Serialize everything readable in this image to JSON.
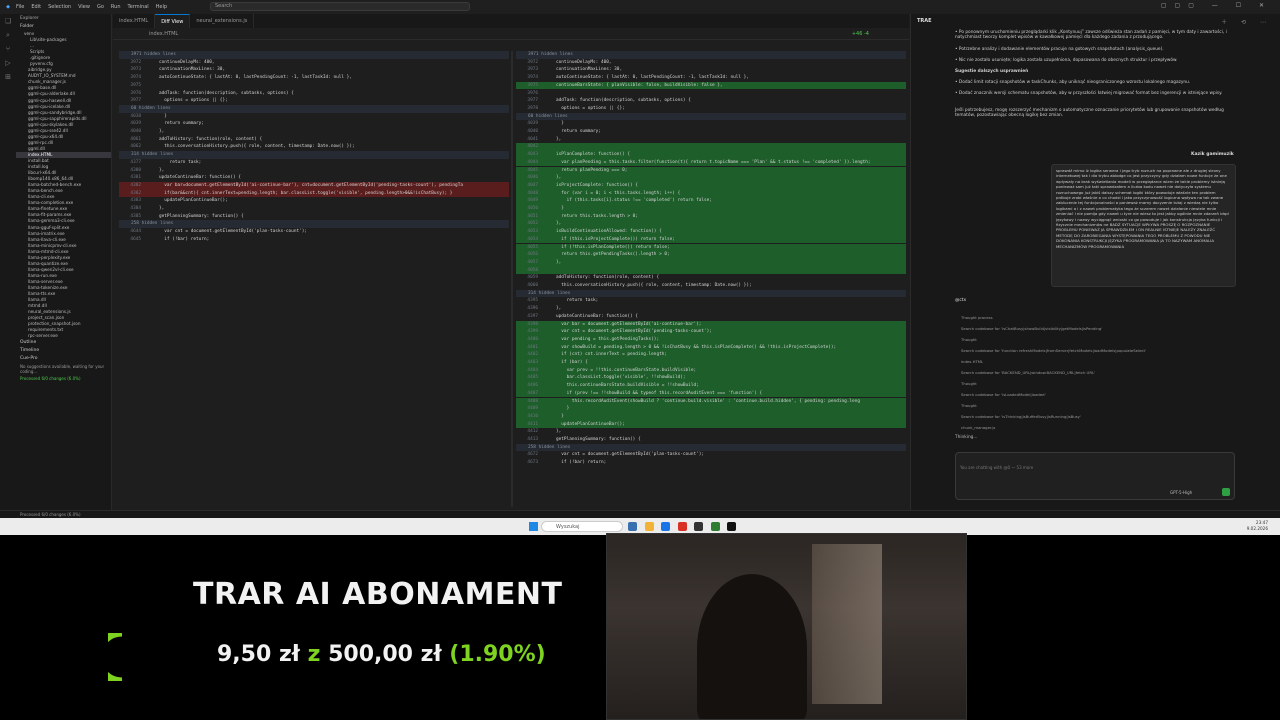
{
  "titlebar": {
    "menu": [
      "File",
      "Edit",
      "Selection",
      "View",
      "Go",
      "Run",
      "Terminal",
      "Help"
    ],
    "search": "Search"
  },
  "explorer": {
    "header": "Explorer",
    "folder": "Folder",
    "tree": [
      "venv",
      "Lib\\site-packages",
      "...",
      "Scripts",
      ".gitignore",
      "pyvenv.cfg",
      "aibridge.py",
      "AUDYT_IO_SYSTEM.md",
      "chunk_manager.js",
      "ggml-base.dll",
      "ggml-cpu-alderlake.dll",
      "ggml-cpu-haswell.dll",
      "ggml-cpu-icelake.dll",
      "ggml-cpu-sandybridge.dll",
      "ggml-cpu-sapphirerapids.dll",
      "ggml-cpu-skylakex.dll",
      "ggml-cpu-sse42.dll",
      "ggml-cpu-x64.dll",
      "ggml-rpc.dll",
      "ggml.dll",
      "index.HTML",
      "install.bat",
      "install.log",
      "libcurl-x64.dll",
      "libomp140.x86_64.dll",
      "llama-batched-bench.exe",
      "llama-bench.exe",
      "llama-cli.exe",
      "llama-completion.exe",
      "llama-finetune.exe",
      "llama-fit-params.exe",
      "llama-gemma3-cli.exe",
      "llama-gguf-split.exe",
      "llama-imatrix.exe",
      "llama-llava-cli.exe",
      "llama-minicpmv-cli.exe",
      "llama-mtmd-cli.exe",
      "llama-perplexity.exe",
      "llama-quantize.exe",
      "llama-qwen2vl-cli.exe",
      "llama-run.exe",
      "llama-server.exe",
      "llama-tokenize.exe",
      "llama-tts.exe",
      "llama.dll",
      "mtmd.dll",
      "neural_extensions.js",
      "project_scan.json",
      "protection_snapshot.json",
      "requirements.txt",
      "rpc-server.exe"
    ],
    "selected": "index.HTML",
    "outline": "Outline",
    "timeline": "Timeline",
    "cursor": "Cue-Pro",
    "cursor_note": "No suggestions available, waiting for your coding...",
    "cursor_status": "Processed 6/0 changes (6.0%)"
  },
  "tabs": [
    "index.HTML",
    "Diff View",
    "neural_extensions.js"
  ],
  "breadcrumb": "index.HTML",
  "diff_stat": "+46 -4",
  "left_pane": [
    {
      "t": "hidden",
      "text": "3971 hidden lines"
    },
    {
      "n": "3972",
      "text": "continueDelayMs: 400,"
    },
    {
      "n": "3973",
      "text": "continuationMaxLines: 30,"
    },
    {
      "n": "3974",
      "text": "autoContinueState: { lastAt: 0, lastPendingCount: -1, lastTaskId: null },"
    },
    {
      "n": "3975",
      "text": ""
    },
    {
      "n": "3976",
      "text": "addTask: function(description, subtasks, options) {"
    },
    {
      "n": "3977",
      "text": "  options = options || {};"
    },
    {
      "t": "hidden",
      "text": "60 hidden lines"
    },
    {
      "n": "4038",
      "text": "  }"
    },
    {
      "n": "4039",
      "text": "  return summary;"
    },
    {
      "n": "4040",
      "text": "},"
    },
    {
      "n": "4061",
      "text": "addToHistory: function(role, content) {"
    },
    {
      "n": "4062",
      "text": "  this.conversationHistory.push({ role, content, timestamp: Date.now() });"
    },
    {
      "t": "hidden",
      "text": "314 hidden lines"
    },
    {
      "n": "4377",
      "text": "    return task;"
    },
    {
      "n": "4380",
      "text": "},"
    },
    {
      "n": "4381",
      "text": "updateContinueBar: function() {"
    },
    {
      "n": "4382",
      "text": "  var bar=document.getElementById('ai-continue-bar'), cnt=document.getElementById('pending-tasks-count'), pendingTa"
    },
    {
      "n": "4382",
      "text": "  if(bar&&cnt){ cnt.innerText=pending.length; bar.classList.toggle('visible', pending.length>0&&!isChatBusy); }"
    },
    {
      "n": "4383",
      "text": "  updatePlanContinueBar();"
    },
    {
      "n": "4384",
      "text": "},"
    },
    {
      "n": "4385",
      "text": "getPlanningSummary: function() {"
    },
    {
      "t": "hidden",
      "text": "258 hidden lines"
    },
    {
      "n": "4644",
      "text": "  var cnt = document.getElementById('plan-tasks-count');"
    },
    {
      "n": "4645",
      "text": "  if (!bar) return;"
    }
  ],
  "right_pane": [
    {
      "t": "hidden",
      "text": "3971 hidden lines"
    },
    {
      "n": "3972",
      "text": "continueDelayMs: 400,"
    },
    {
      "n": "3973",
      "text": "continuationMaxLines: 30,"
    },
    {
      "n": "3974",
      "text": "autoContinueState: { lastAt: 0, lastPendingCount: -1, lastTaskId: null },"
    },
    {
      "n": "3975",
      "text": "continueBarsState: { planVisible: false, buildVisible: false },"
    },
    {
      "n": "3976",
      "text": ""
    },
    {
      "n": "3977",
      "text": "addTask: function(description, subtasks, options) {"
    },
    {
      "n": "3978",
      "text": "  options = options || {};"
    },
    {
      "t": "hidden",
      "text": "60 hidden lines"
    },
    {
      "n": "4039",
      "text": "  }"
    },
    {
      "n": "4040",
      "text": "  return summary;"
    },
    {
      "n": "4041",
      "text": "},"
    },
    {
      "n": "4042",
      "text": ""
    },
    {
      "n": "4043",
      "text": "isPlanComplete: function() {"
    },
    {
      "n": "4044",
      "text": "  var planPending = this.tasks.filter(function(t){ return t.topicName === 'Plan' && t.status !== 'completed' }).length;"
    },
    {
      "n": "4045",
      "text": "  return planPending === 0;"
    },
    {
      "n": "4046",
      "text": "},"
    },
    {
      "n": "4047",
      "text": "isProjectComplete: function() {"
    },
    {
      "n": "4048",
      "text": "  for (var i = 0; i < this.tasks.length; i++) {"
    },
    {
      "n": "4049",
      "text": "    if (this.tasks[i].status !== 'completed') return false;"
    },
    {
      "n": "4050",
      "text": "  }"
    },
    {
      "n": "4051",
      "text": "  return this.tasks.length > 0;"
    },
    {
      "n": "4052",
      "text": "},"
    },
    {
      "n": "4053",
      "text": "isBuildContinuationAllowed: function() {"
    },
    {
      "n": "4054",
      "text": "  if (this.isProjectComplete()) return false;"
    },
    {
      "n": "4055",
      "text": "  if (!this.isPlanComplete()) return false;"
    },
    {
      "n": "4056",
      "text": "  return this.getPendingTasks().length > 0;"
    },
    {
      "n": "4057",
      "text": "},"
    },
    {
      "n": "4058",
      "text": ""
    },
    {
      "n": "4059",
      "text": "addToHistory: function(role, content) {"
    },
    {
      "n": "4060",
      "text": "  this.conversationHistory.push({ role, content, timestamp: Date.now() });"
    },
    {
      "t": "hidden",
      "text": "314 hidden lines"
    },
    {
      "n": "4395",
      "text": "    return task;"
    },
    {
      "n": "4396",
      "text": "},"
    },
    {
      "n": "4397",
      "text": "updateContinueBar: function() {"
    },
    {
      "n": "4398",
      "text": "  var bar = document.getElementById('ai-continue-bar');"
    },
    {
      "n": "4399",
      "text": "  var cnt = document.getElementById('pending-tasks-count');"
    },
    {
      "n": "4400",
      "text": "  var pending = this.getPendingTasks();"
    },
    {
      "n": "4401",
      "text": "  var showBuild = pending.length > 0 && !isChatBusy && this.isPlanComplete() && !this.isProjectComplete();"
    },
    {
      "n": "4402",
      "text": "  if (cnt) cnt.innerText = pending.length;"
    },
    {
      "n": "4403",
      "text": "  if (bar) {"
    },
    {
      "n": "4404",
      "text": "    var prev = !!this.continueBarsState.buildVisible;"
    },
    {
      "n": "4405",
      "text": "    bar.classList.toggle('visible', !!showBuild);"
    },
    {
      "n": "4406",
      "text": "    this.continueBarsState.buildVisible = !!showBuild;"
    },
    {
      "n": "4407",
      "text": "    if (prev !== !!showBuild && typeof this.recordAuditEvent === 'function') {"
    },
    {
      "n": "4408",
      "text": "      this.recordAuditEvent(showBuild ? 'continue.build.visible' : 'continue.build.hidden', { pending: pending.leng"
    },
    {
      "n": "4409",
      "text": "    }"
    },
    {
      "n": "4410",
      "text": "  }"
    },
    {
      "n": "4411",
      "text": "  updatePlanContinueBar();"
    },
    {
      "n": "4412",
      "text": "},"
    },
    {
      "n": "4413",
      "text": "getPlanningSummary: function() {"
    },
    {
      "t": "hidden",
      "text": "258 hidden lines"
    },
    {
      "n": "4672",
      "text": "  var cnt = document.getElementById('plan-tasks-count');"
    },
    {
      "n": "4673",
      "text": "  if (!bar) return;"
    }
  ],
  "chat": {
    "title": "TRAE",
    "assistant_text": [
      "Po ponownym uruchomieniu przeglądarki klik „Kontynuuj” zawsze odświeża stan zadań z pamięci, w tym daty i zawartości, i natychmiast tworzy komplet wpisów w kawałkowej pamięci dla każdego zadania z przodującego.",
      "Potrzebne analizy i dodawanie elementów pracuje na gotowych snapshotach (analysis_queue).",
      "Nic nie zostało usunięte; logika została uzupełniona, dopasowana do obecnych struktur i przepływów.",
      "Sugestie dalszych usprawnień",
      "Dodać limit rotacji snapshotów w taskChunks, aby uniknąć nieograniczonego wzrostu lokalnego magazynu.",
      "Dodać znacznik wersji schematu snapshotów, aby w przyszłości łatwiej migrować format bez ingerencji w istniejące wpisy.",
      "Jeśli potrzebujesz, mogę rozszerzyć mechanizm o automatyczne oznaczanie priorytetów lub grupowanie snapshotów według tematów, pozostawiając obecną logikę bez zmian."
    ],
    "user_name": "Kazik gamimuzik",
    "user_message": "sprawdź mimo iż logika serwera i jego tryb rozruch na poprawne ale z drugiej strony internetowej tak i dla trybu ablodge co jest przyczyny gdy działam nowe funkcje że one wpływały na brak wyświetlania modeli w przeglądarce wiem że takie problemy istnieją ponieważ sam już taki sprawdzałem a liczba kodu nawet nie dotyczyła systemu rozruchowego już jakiś dalszy schemat logiki który powoduje właśnie ten problem próbuje zrobi właśnie o co chodzi i jaka przyczynowość logiczna wpływa na tak zwane zablucenie tej funkcjonalności a ponieważ mamy docyzenie tutaj z wiedzą nie tylko logikami a i z nawet problematyka tego że sczerem nawet działanie niewiele mnie zmieniać i nie pomija gdy nawet u tyre nie wiesz to jest jakby ogólnie mnie zdarzeń błąd językowy i nazwy wyciągnąć wnioski co go powoduje i jak konstrukcja języka funkcji i fizycznie mechanizmów ne BADŹ SYTUACJE WPŁYWA PROSZĘ O ROZPOZNANIE PROBLEMU PONIEWAŻ JA SPRAWDZIŁEM I ON REALNIE ISTNIEJE NALEŻY ZNALEŹĆ METODĘ DO ZAROBIEGANIA WYSTĘPOWANIA TEGO PROBLEMU Z POWODU NIE DOKONANIA KONSTRUKCJI JĘZYKA PROGRAMOWANIA JA TO NAZYWAM ANOMALIA MECHANIZMÓW PROGRAMOWANIA",
    "steps": [
      "Thought process",
      "Search codebase for 'isChatBusy|showBuild|visibility|getModels|isPending'",
      "Thought",
      "Search codebase for 'function refreshModels|fromServer|fetchModels|loadModels|populateSelect'",
      "index.HTML",
      "Search codebase for 'BACKEND_URL|window.BACKEND_URL|fetch URL'",
      "Thought",
      "Search codebase for 'isLoadedModel|loaded'",
      "Thought",
      "Search codebase for 'isThinking|isBufferBusy|isRunning|isBusy'",
      "chunk_manager.js"
    ],
    "thinking": "Thinking...",
    "context_badge": "@ctx",
    "input_placeholder": "You are chatting with @0 — 53 more",
    "model": "GPT-5-High"
  },
  "statusbar": "Processed 6/0 changes (6.0%)",
  "taskbar": {
    "search": "Wyszukaj",
    "time": "23:47",
    "date": "9.02.2026"
  },
  "overlay": {
    "title": "TRAR AI ABONAMENT",
    "current": "9,50 zł",
    "connector": "z",
    "goal": "500,00 zł",
    "percent": "(1.90%)",
    "progress_fraction": 0.019,
    "accent_color": "#7ed321"
  }
}
